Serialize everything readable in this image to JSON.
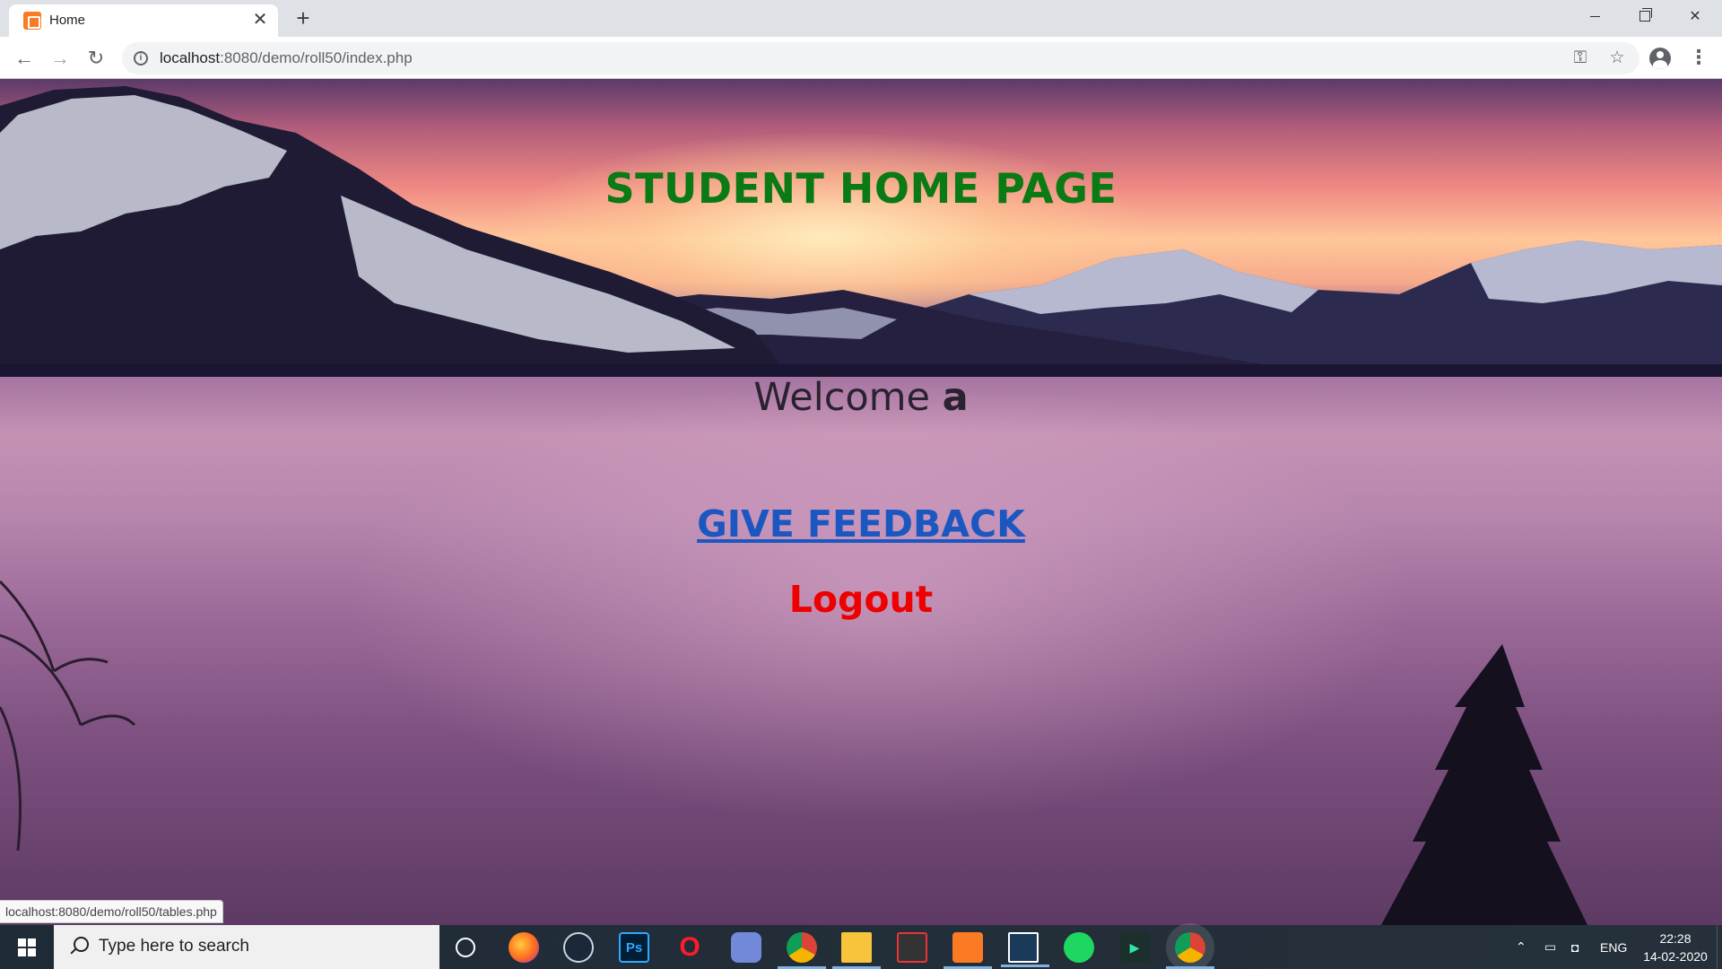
{
  "browser": {
    "tab_title": "Home",
    "tab_close": "✕",
    "new_tab": "+",
    "url_host": "localhost",
    "url_rest": ":8080/demo/roll50/index.php",
    "window_controls": {
      "minimize": "minimize",
      "maximize": "restore",
      "close": "✕"
    }
  },
  "page": {
    "heading": "STUDENT HOME PAGE",
    "welcome_text": "Welcome ",
    "welcome_user": "a",
    "feedback_link": "GIVE FEEDBACK",
    "logout_link": "Logout",
    "heading_color": "#0a7a14",
    "feedback_color": "#1a57c0",
    "logout_color": "#ee0000"
  },
  "status_bar": {
    "hover_url": "localhost:8080/demo/roll50/tables.php"
  },
  "taskbar": {
    "search_placeholder": "Type here to search",
    "apps": [
      {
        "name": "firefox-icon",
        "label": ""
      },
      {
        "name": "steam-icon",
        "label": ""
      },
      {
        "name": "photoshop-icon",
        "label": "Ps"
      },
      {
        "name": "opera-icon",
        "label": "O"
      },
      {
        "name": "discord-icon",
        "label": ""
      },
      {
        "name": "chrome-icon",
        "label": ""
      },
      {
        "name": "file-explorer-icon",
        "label": ""
      },
      {
        "name": "media-app-icon",
        "label": ""
      },
      {
        "name": "xampp-icon",
        "label": ""
      },
      {
        "name": "sublime-icon",
        "label": ""
      },
      {
        "name": "spotify-icon",
        "label": ""
      },
      {
        "name": "media-player-icon",
        "label": ""
      },
      {
        "name": "chrome-active-icon",
        "label": ""
      }
    ],
    "tray_language": "ENG",
    "clock_time": "22:28",
    "clock_date": "14-02-2020"
  }
}
